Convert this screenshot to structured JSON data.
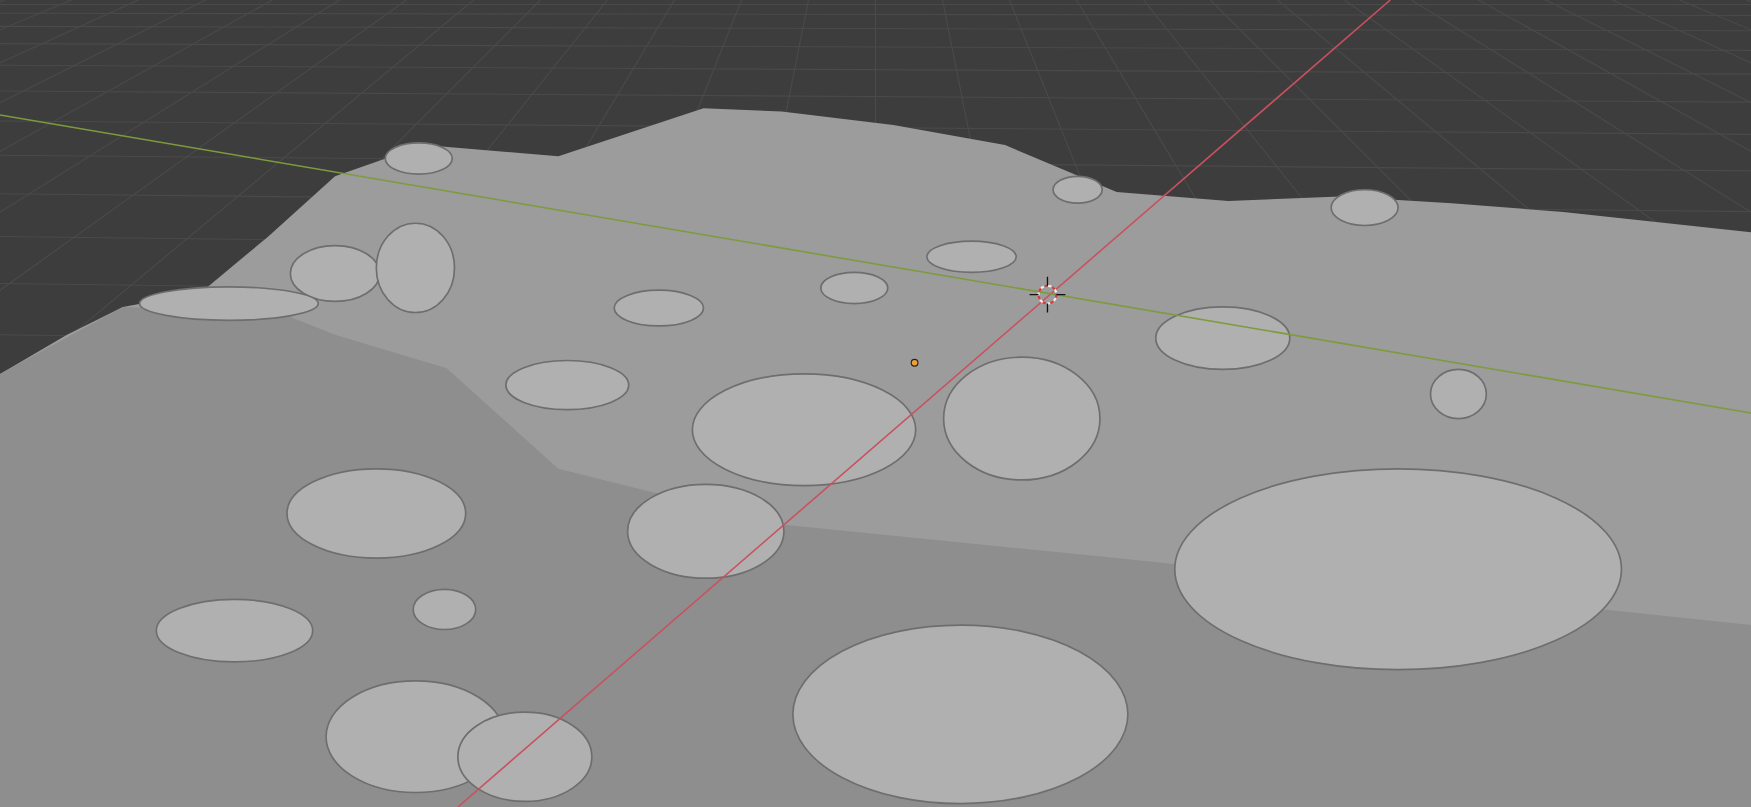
{
  "viewport": {
    "grid": true,
    "axes": [
      {
        "kind": "x",
        "color": "#c9515f"
      },
      {
        "kind": "y",
        "color": "#7d9b3c"
      }
    ]
  }
}
